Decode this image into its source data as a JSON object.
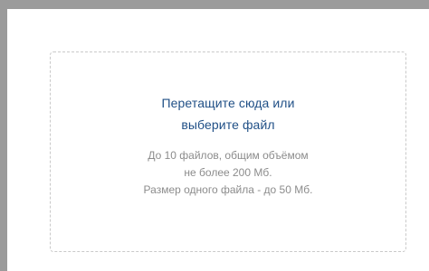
{
  "upload": {
    "cta_line1": "Перетащите сюда или",
    "cta_line2": "выберите файл",
    "limit_line1": "До 10 файлов, общим объёмом",
    "limit_line2": "не более 200 Мб.",
    "limit_line3": "Размер одного файла - до 50 Мб."
  },
  "colors": {
    "frame": "#9b9b9b",
    "cta_text": "#1f4f86",
    "hint_text": "#8c8c8c",
    "dash_border": "#c9c9c9"
  }
}
